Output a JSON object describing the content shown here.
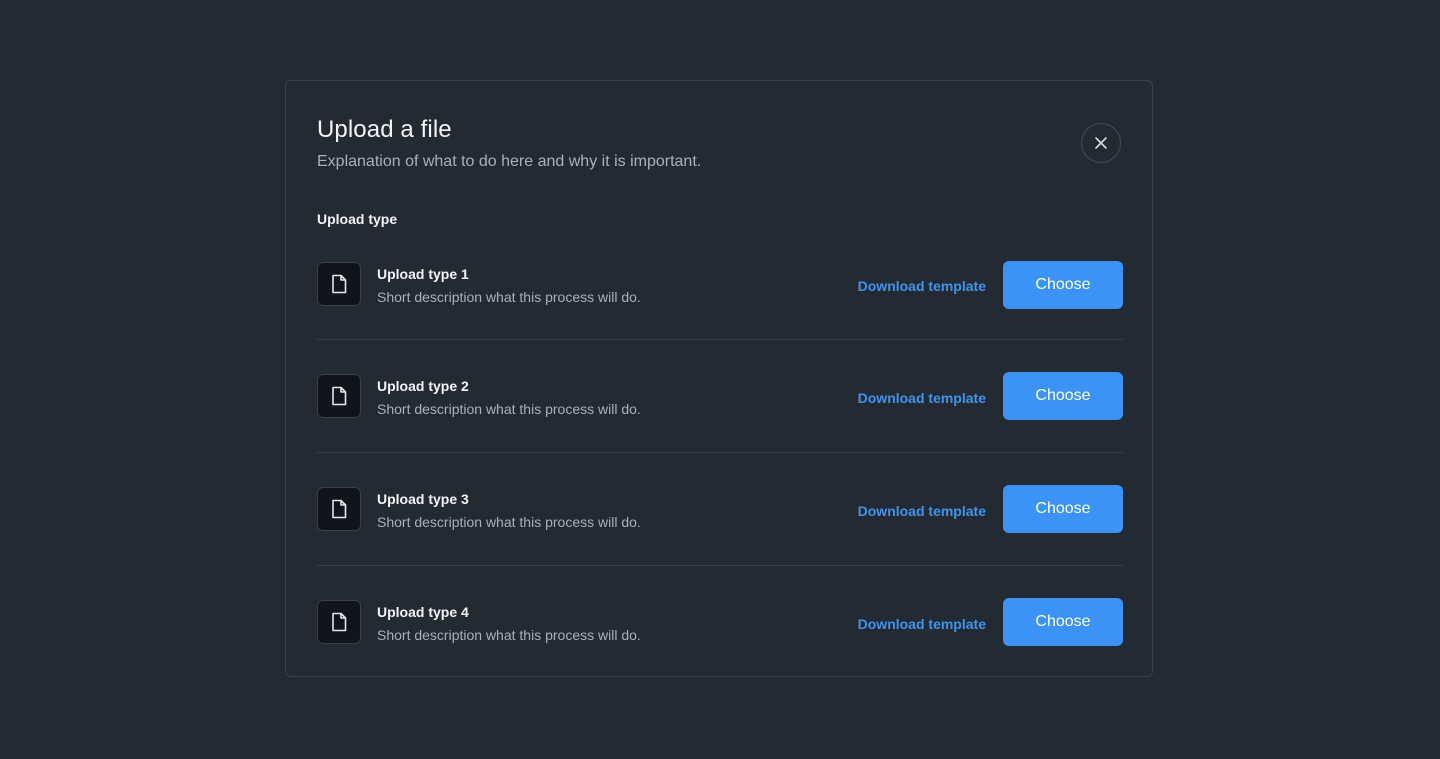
{
  "modal": {
    "title": "Upload a file",
    "subtitle": "Explanation of what to do here and why it is important.",
    "close_icon": "close-icon",
    "section_label": "Upload type"
  },
  "upload_types": [
    {
      "title": "Upload type 1",
      "description": "Short description what this process will do.",
      "download_label": "Download template",
      "choose_label": "Choose",
      "icon": "document-icon"
    },
    {
      "title": "Upload type 2",
      "description": "Short description what this process will do.",
      "download_label": "Download template",
      "choose_label": "Choose",
      "icon": "document-icon"
    },
    {
      "title": "Upload type 3",
      "description": "Short description what this process will do.",
      "download_label": "Download template",
      "choose_label": "Choose",
      "icon": "document-icon"
    },
    {
      "title": "Upload type 4",
      "description": "Short description what this process will do.",
      "download_label": "Download template",
      "choose_label": "Choose",
      "icon": "document-icon"
    }
  ],
  "colors": {
    "background": "#242a32",
    "accent": "#3b93f5",
    "link": "#3d95ee",
    "text_primary": "#f3f4f6",
    "text_secondary": "#a8b0bb",
    "border": "#3a4049"
  }
}
